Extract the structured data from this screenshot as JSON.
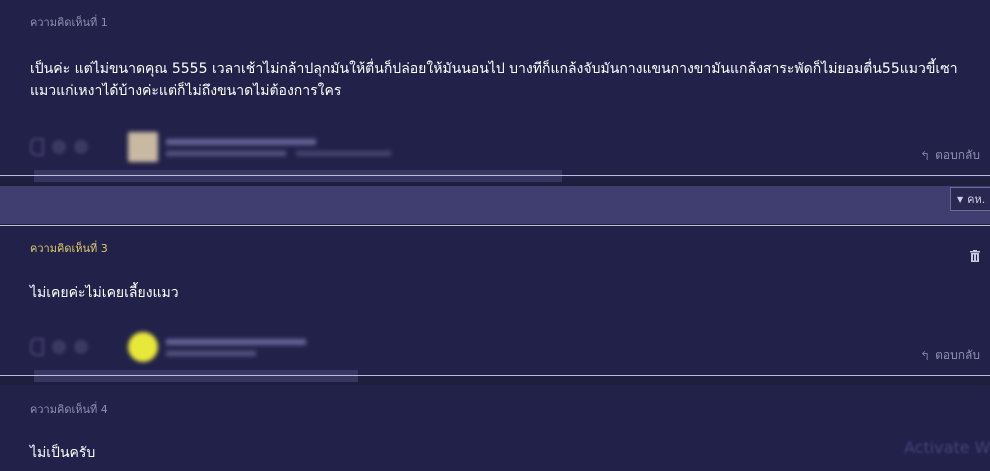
{
  "comments": [
    {
      "header": "ความคิดเห็นที่ 1",
      "body": "เป็นค่ะ แต่ไม่ขนาดคุณ 5555 เวลาเช้าไม่กล้าปลุกมันให้ตื่นก็ปล่อยให้มันนอนไป บางทีก็แกล้งจับมันกางแขนกางขามันแกล้งสาระพัดก็ไม่ยอมตื่น55แมวขี้เซา แมวแก่เหงาได้บ้างค่ะแต่ก็ไม่ถึงขนาดไม่ต้องการใคร",
      "reply_label": "ตอบกลับ"
    },
    {
      "header": "ความคิดเห็นที่ 3",
      "body": "ไม่เคยค่ะไม่เคยเลี้ยงแมว",
      "reply_label": "ตอบกลับ"
    },
    {
      "header": "ความคิดเห็นที่ 4",
      "body": "ไม่เป็นครับ"
    }
  ],
  "sort_button": {
    "label": "คห."
  },
  "watermark": {
    "text": "Activate W"
  },
  "icons": {
    "reply": "reply-arrow-icon",
    "trash": "trash-icon",
    "sort": "caret-down-icon"
  },
  "colors": {
    "background": "#1f1e3f",
    "highlight_header": "#e0c96a",
    "muted_text": "#8f8fb3"
  }
}
